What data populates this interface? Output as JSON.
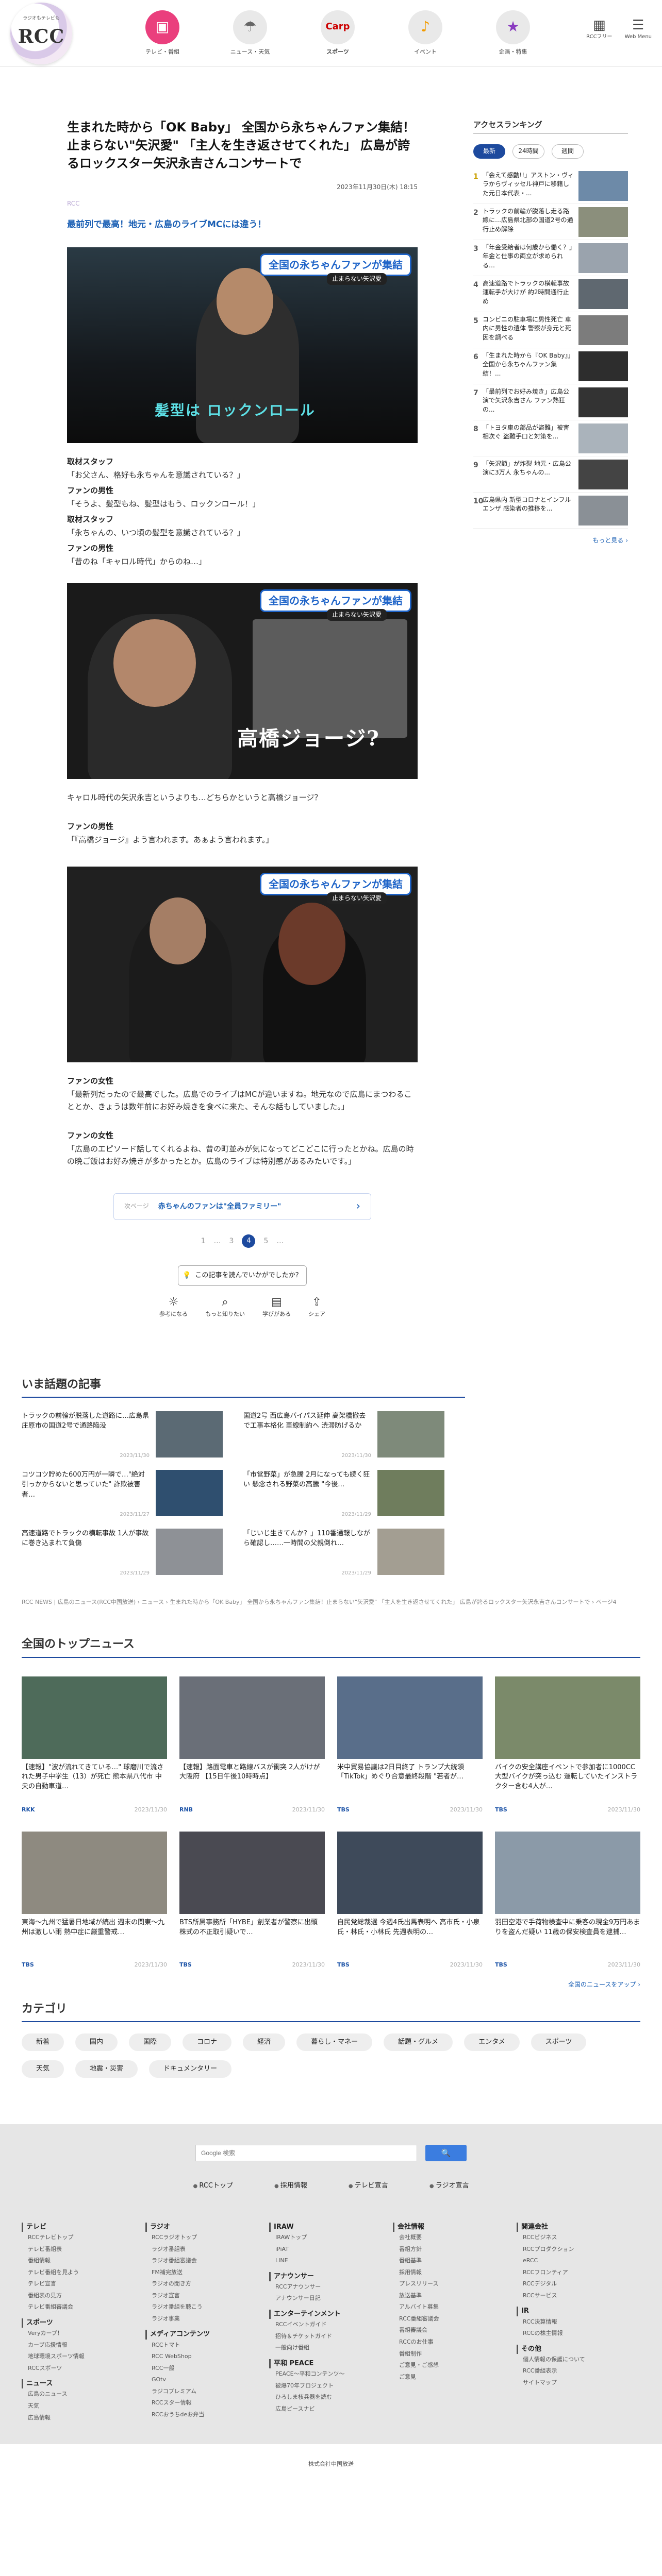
{
  "header": {
    "logo_small": "ラジオもテレビも",
    "logo_text": "RCC",
    "nav": [
      {
        "label": "テレビ・番組",
        "icon": "tv-icon",
        "glyph": "▣"
      },
      {
        "label": "ニュース・天気",
        "icon": "news-icon",
        "glyph": "☂"
      },
      {
        "label": "スポーツ",
        "icon": "carp-icon",
        "glyph": "Carp"
      },
      {
        "label": "イベント",
        "icon": "event-icon",
        "glyph": "♪"
      },
      {
        "label": "企画・特集",
        "icon": "star-icon",
        "glyph": "★"
      }
    ],
    "right": [
      {
        "label": "RCCフリー",
        "glyph": "▦"
      },
      {
        "label": "Web Menu",
        "glyph": "☰"
      }
    ]
  },
  "article": {
    "title": "生まれた時から「OK Baby」 全国から永ちゃんファン集結！止まらない\"矢沢愛\" 「主人を生き返させてくれた」 広島が誇るロックスター矢沢永吉さんコンサートで",
    "date": "2023年11月30日(木) 18:15",
    "maker": "RCC",
    "lead": "最前列で最高！地元・広島のライブMCには違う！",
    "photo1": {
      "tag": "全国の永ちゃんファンが集結",
      "sub": "止まらない矢沢愛",
      "caption": "髪型は ロックンロール"
    },
    "dialog1": [
      {
        "speaker": "取材スタッフ",
        "line": "「お父さん、格好も永ちゃんを意識されている？」"
      },
      {
        "speaker": "ファンの男性",
        "line": "「そうよ、髪型もね、髪型はもう、ロックンロール！」"
      },
      {
        "speaker": "取材スタッフ",
        "line": "「永ちゃんの、いつ頃の髪型を意識されている？」"
      },
      {
        "speaker": "ファンの男性",
        "line": "「昔のね「キャロル時代」からのね…」"
      }
    ],
    "photo2": {
      "tag": "全国の永ちゃんファンが集結",
      "sub": "止まらない矢沢愛",
      "caption": "高橋ジョージ?"
    },
    "para2": "キャロル時代の矢沢永吉というよりも…どちらかというと高橋ジョージ？",
    "dialog2": [
      {
        "speaker": "ファンの男性",
        "line": "「『高橋ジョージ』よう言われます。あぁよう言われます。」"
      }
    ],
    "photo3": {
      "tag": "全国の永ちゃんファンが集結",
      "sub": "止まらない矢沢愛"
    },
    "dialog3": [
      {
        "speaker": "ファンの女性",
        "line": "「最新列だったので最高でした。広島でのライブはMCが違いますね。地元なので広島にまつわることとか、きょうは数年前にお好み焼きを食べに来た、そんな話もしていました。」"
      },
      {
        "speaker": "ファンの女性",
        "line": "「広島のエピソード話してくれるよね、昔の町並みが気になってどこどこに行ったとかね。広島の時の晩ご飯はお好み焼きが多かったとか。広島のライブは特別感があるみたいです。」"
      }
    ]
  },
  "next": {
    "label": "次ページ",
    "title": "赤ちゃんのファンは\"全員ファミリー\"",
    "arrow": "›"
  },
  "pager": {
    "pages": [
      "1",
      "…",
      "3",
      "4",
      "5",
      "…"
    ],
    "current": "4"
  },
  "feedback": {
    "label": "この記事を読んでいかがでしたか？"
  },
  "reactions": [
    {
      "label": "参考になる",
      "glyph": "☼"
    },
    {
      "label": "もっと知りたい",
      "glyph": "⌕"
    },
    {
      "label": "学びがある",
      "glyph": "▤"
    },
    {
      "label": "シェア",
      "glyph": "⇪"
    }
  ],
  "ranking": {
    "title": "アクセスランキング",
    "tabs": [
      "最新",
      "24時間",
      "週間"
    ],
    "active_tab": "最新",
    "items": [
      {
        "n": "1",
        "text": "「会えて感動!!」アストン・ヴィラからヴィッセル神戸に移籍した元日本代表・..."
      },
      {
        "n": "2",
        "text": "トラックの前輪が脱落し走る路線に…広島県北部の国道2号の通行止め解除"
      },
      {
        "n": "3",
        "text": "「年金受給者は何歳から働く？」年金と仕事の両立が求められる…"
      },
      {
        "n": "4",
        "text": "高速道路でトラックの横転事故 運転手が大けが 約2時間通行止め"
      },
      {
        "n": "5",
        "text": "コンビニの駐車場に男性死亡 車内に男性の遺体 警察が身元と死因を調べる"
      },
      {
        "n": "6",
        "text": "「生まれた時から『OK Baby』」全国から永ちゃんファン集結！..."
      },
      {
        "n": "7",
        "text": "「最前列でお好み焼き」広島公演で矢沢永吉さん ファン熱狂の..."
      },
      {
        "n": "8",
        "text": "「トヨタ車の部品が盗難」被害相次ぐ 盗難手口と対策を..."
      },
      {
        "n": "9",
        "text": "「矢沢節」が炸裂 地元・広島公演に3万人 永ちゃんの..."
      },
      {
        "n": "10",
        "text": "広島県内 新型コロナとインフルエンザ 感染者の推移を..."
      }
    ],
    "more": "もっと見る ›"
  },
  "topics": {
    "title": "いま話題の記事",
    "items": [
      {
        "text": "トラックの前輪が脱落した道路に…広島県庄原市の国道2号で通路陥没",
        "date": "2023/11/30"
      },
      {
        "text": "国道2号 西広島バイパス延伸 高架橋撤去で工事本格化 車線制約へ 渋滞防げるか",
        "date": "2023/11/30"
      },
      {
        "text": "コツコツ貯めた600万円が一瞬で…\"絶対引っかからないと思っていた\" 詐欺被害者…",
        "date": "2023/11/27"
      },
      {
        "text": "「市営野菜」が急騰 2月になっても続く狂い 懸念される野菜の高騰 \"今後…",
        "date": "2023/11/29"
      },
      {
        "text": "高速道路でトラックの横転事故 1人が事故に巻き込まれて負傷",
        "date": "2023/11/29"
      },
      {
        "text": "「じいじ生きてんか？」110番通報しながら確認し……一時間の父親倒れ…",
        "date": "2023/11/29"
      }
    ]
  },
  "breadcrumb": "RCC NEWS | 広島のニュース(RCC中国放送)  ›  ニュース  ›  生まれた時から「OK Baby」 全国から永ちゃんファン集結！止まらない\"矢沢愛\" 「主人を生き返させてくれた」 広島が誇るロックスター矢沢永吉さんコンサートで  ›  ページ4",
  "topnews": {
    "title": "全国のトップニュース",
    "items": [
      {
        "text": "【速報】\"波が流れてきている…\" 球磨川で流された男子中学生（13）が死亡 熊本県八代市 中央の自動車道…",
        "src": "RKK",
        "date": "2023/11/30"
      },
      {
        "text": "【速報】路面電車と路線バスが衝突 2人がけが 大阪府 【15日午後10時時点】",
        "src": "RNB",
        "date": "2023/11/30"
      },
      {
        "text": "米中貿易協議は2日目終了 トランプ大統領「TikTok」めぐり合意最終段階 \"若者が…",
        "src": "TBS",
        "date": "2023/11/30"
      },
      {
        "text": "バイクの安全講座イベントで参加者に1000CC大型バイクが突っ込む 運転していたインストラクター含む4人が…",
        "src": "TBS",
        "date": "2023/11/30"
      },
      {
        "text": "東海～九州で猛暑日地域が続出 週末の関東～九州は激しい雨 熱中症に厳重警戒…",
        "src": "TBS",
        "date": "2023/11/30"
      },
      {
        "text": "BTS所属事務所「HYBE」創業者が警察に出頭 株式の不正取引疑いで…",
        "src": "TBS",
        "date": "2023/11/30"
      },
      {
        "text": "自民党総裁選 今週4氏出馬表明へ 高市氏・小泉氏・林氏・小林氏 先週表明の…",
        "src": "TBS",
        "date": "2023/11/30"
      },
      {
        "text": "羽田空港で手荷物検査中に乗客の現金9万円あまりを盗んだ疑い 11歳の保安検査員を逮捕…",
        "src": "TBS",
        "date": "2023/11/30"
      }
    ],
    "more": "全国のニュースをアップ ›"
  },
  "categories": {
    "title": "カテゴリ",
    "items": [
      "新着",
      "国内",
      "国際",
      "コロナ",
      "経済",
      "暮らし・マネー",
      "話題・グルメ",
      "エンタメ",
      "スポーツ",
      "天気",
      "地震・災害",
      "ドキュメンタリー"
    ]
  },
  "footer": {
    "search_placeholder": "Google 検索",
    "search_button": "🔍",
    "links": [
      "RCCトップ",
      "採用情報",
      "テレビ宣言",
      "ラジオ宣言"
    ],
    "cols": [
      {
        "groups": [
          {
            "h": "テレビ",
            "items": [
              "RCCテレビトップ",
              "テレビ番組表",
              "番組情報",
              "テレビ番組を見よう",
              "テレビ宣言",
              "番組表の見方",
              "テレビ番組審議会"
            ]
          },
          {
            "h": "スポーツ",
            "items": [
              "Veryカープ！",
              "カープ応援情報",
              "地球環境スポーツ情報",
              "RCCスポーツ"
            ]
          },
          {
            "h": "ニュース",
            "items": [
              "広島のニュース",
              "天気",
              "広島情報"
            ]
          }
        ]
      },
      {
        "groups": [
          {
            "h": "ラジオ",
            "items": [
              "RCCラジオトップ",
              "ラジオ番組表",
              "ラジオ番組審議会",
              "FM補完放送",
              "ラジオの聞き方",
              "ラジオ宣言",
              "ラジオ番組を聴こう",
              "ラジオ事業"
            ]
          },
          {
            "h": "メディアコンテンツ",
            "items": [
              "RCCトマト",
              "RCC WebShop",
              "RCC一般",
              "GOtv",
              "ラジコプレミアム",
              "RCCスター情報",
              "RCCおうちdeお弁当"
            ]
          }
        ]
      },
      {
        "groups": [
          {
            "h": "IRAW",
            "items": [
              "IRAWトップ",
              "iPiAT",
              "LINE"
            ]
          },
          {
            "h": "アナウンサー",
            "items": [
              "RCCアナウンサー",
              "アナウンサー日記"
            ]
          },
          {
            "h": "エンターテインメント",
            "items": [
              "RCCイベントガイド",
              "招待＆チケットガイド",
              "一般向け番組"
            ]
          },
          {
            "h": "平和 PEACE",
            "items": [
              "PEACE～平和コンテンツ～",
              "被爆70年プロジェクト",
              "ひろしま核兵器を読む",
              "広島ピースナビ"
            ]
          }
        ]
      },
      {
        "groups": [
          {
            "h": "会社情報",
            "items": [
              "会社概要",
              "番組方針",
              "番組基準",
              "採用情報",
              "プレスリリース",
              "放送基準",
              "アルバイト募集",
              "RCC番組審議会",
              "番組審議会",
              "RCCのお仕事",
              "番組制作",
              "ご意見・ご感想",
              "ご意見"
            ]
          }
        ]
      },
      {
        "groups": [
          {
            "h": "関連会社",
            "items": [
              "RCCビジネス",
              "RCCプロダクション",
              "eRCC",
              "RCCフロンティア",
              "RCCデジタル",
              "RCCサービス"
            ]
          },
          {
            "h": "IR",
            "items": [
              "RCC決算情報",
              "RCCの株主情報"
            ]
          },
          {
            "h": "その他",
            "items": [
              "個人情報の保護について",
              "RCC番組表示",
              "サイトマップ"
            ]
          }
        ]
      }
    ],
    "copyright": "株式会社中国放送"
  },
  "colors": {
    "accent": "#1d4a9e",
    "pink": "#ea3f7d",
    "link": "#1a5fb4"
  }
}
